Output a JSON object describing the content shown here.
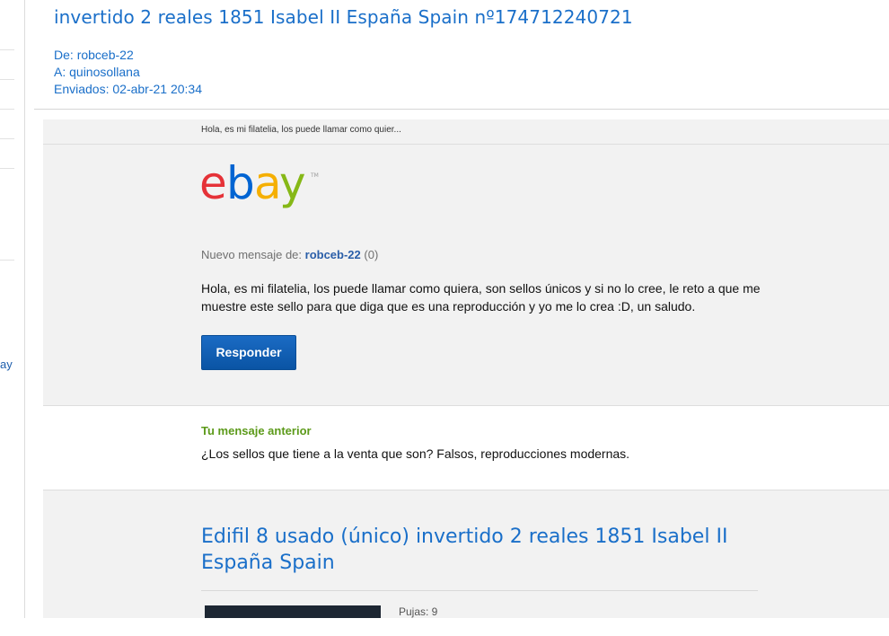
{
  "sidebar": {
    "peek_text": "ay"
  },
  "message": {
    "subject": "invertido 2 reales 1851 Isabel II España Spain nº174712240721",
    "from_label": "De:",
    "from": "robceb-22",
    "to_label": "A:",
    "to": "quinosollana",
    "sent_label": "Enviados:",
    "sent": "02-abr-21 20:34"
  },
  "email": {
    "preheader": "Hola, es mi filatelia, los puede llamar como quier...",
    "logo_text": "ebay",
    "new_message_label": "Nuevo mensaje de:",
    "sender": "robceb-22",
    "sender_feedback": "(0)",
    "body": "Hola, es mi filatelia, los puede llamar como quiera, son sellos únicos y si no lo cree, le reto a que me muestre este sello para que diga que es una reproducción y yo me lo crea :D, un saludo.",
    "reply_button": "Responder",
    "previous_title": "Tu mensaje anterior",
    "previous_text": "¿Los sellos que tiene a la venta que son? Falsos, reproducciones modernas.",
    "item_title": "Edifil 8 usado (único) invertido 2 reales 1851 Isabel II España Spain",
    "bids": "Pujas: 9"
  },
  "colors": {
    "link_blue": "#1a6fc9",
    "button_blue": "#0a54a4",
    "green_heading": "#5c9a1a",
    "ebay_red": "#e53238",
    "ebay_blue": "#0064d2",
    "ebay_yellow": "#f5af02",
    "ebay_green": "#86b817"
  }
}
